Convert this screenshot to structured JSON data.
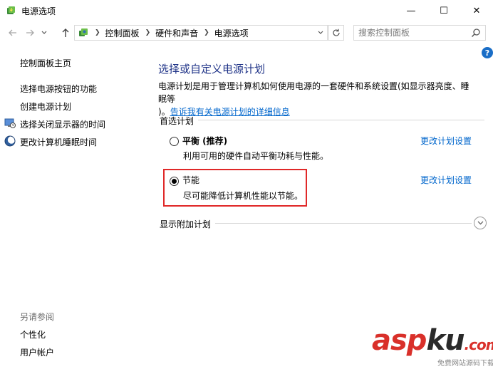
{
  "window": {
    "title": "电源选项",
    "minimize_glyph": "—",
    "maximize_glyph": "☐",
    "close_glyph": "✕"
  },
  "address": {
    "breadcrumbs": [
      "控制面板",
      "硬件和声音",
      "电源选项"
    ],
    "search_placeholder": "搜索控制面板"
  },
  "help_label": "?",
  "sidebar": {
    "home": "控制面板主页",
    "items": [
      {
        "label": "选择电源按钮的功能",
        "icon": "none"
      },
      {
        "label": "创建电源计划",
        "icon": "none"
      },
      {
        "label": "选择关闭显示器的时间",
        "icon": "monitor-clock-icon"
      },
      {
        "label": "更改计算机睡眠时间",
        "icon": "moon-icon"
      }
    ],
    "see_also_title": "另请参阅",
    "see_also": [
      "个性化",
      "用户帐户"
    ]
  },
  "main": {
    "title": "选择或自定义电源计划",
    "description_line1": "电源计划是用于管理计算机如何使用电源的一套硬件和系统设置(如显示器亮度、睡眠等",
    "description_line2_prefix": ")。",
    "description_link": "告诉我有关电源计划的详细信息",
    "preferred_label": "首选计划",
    "plans": [
      {
        "name": "平衡 (推荐)",
        "description": "利用可用的硬件自动平衡功耗与性能。",
        "link": "更改计划设置",
        "selected": false
      },
      {
        "name": "节能",
        "description": "尽可能降低计算机性能以节能。",
        "link": "更改计划设置",
        "selected": true
      }
    ],
    "more_plans_label": "显示附加计划"
  },
  "watermark": {
    "main": "aspku.com",
    "sub": "免费网站源码下载站!",
    "colors": {
      "red": "#d9302a",
      "dark": "#2a2a2a"
    }
  }
}
